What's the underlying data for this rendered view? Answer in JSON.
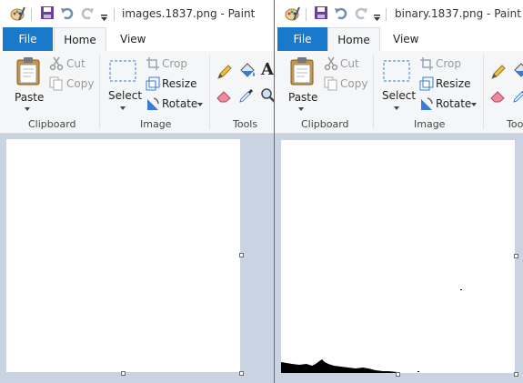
{
  "windows": [
    {
      "title": "images.1837.png - Paint",
      "tabs": {
        "file": "File",
        "home": "Home",
        "view": "View"
      },
      "clipboard": {
        "paste": "Paste",
        "cut": "Cut",
        "copy": "Copy",
        "group": "Clipboard"
      },
      "image": {
        "select": "Select",
        "crop": "Crop",
        "resize": "Resize",
        "rotate": "Rotate",
        "group": "Image"
      },
      "tools": {
        "group": "Tools",
        "text_tool": "A"
      }
    },
    {
      "title": "binary.1837.png - Paint",
      "tabs": {
        "file": "File",
        "home": "Home",
        "view": "View"
      },
      "clipboard": {
        "paste": "Paste",
        "cut": "Cut",
        "copy": "Copy",
        "group": "Clipboard"
      },
      "image": {
        "select": "Select",
        "crop": "Crop",
        "resize": "Resize",
        "rotate": "Rotate",
        "group": "Image"
      },
      "tools": {
        "group": "Tools"
      }
    }
  ],
  "colors": {
    "file_tab": "#1979ca",
    "ribbon": "#f5f6f7",
    "workspace": "#c9d3e2",
    "canvas": "#ffffff"
  }
}
